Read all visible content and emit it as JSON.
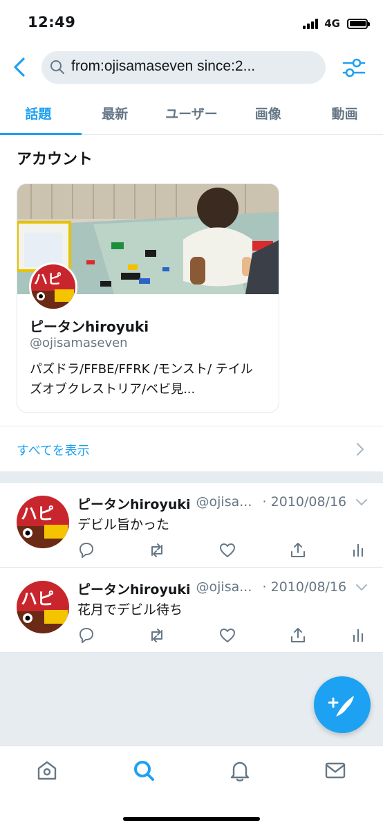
{
  "status_bar": {
    "time": "12:49",
    "network": "4G"
  },
  "search": {
    "query": "from:ojisamaseven since:2..."
  },
  "tabs": [
    {
      "label": "話題",
      "active": true
    },
    {
      "label": "最新",
      "active": false
    },
    {
      "label": "ユーザー",
      "active": false
    },
    {
      "label": "画像",
      "active": false
    },
    {
      "label": "動画",
      "active": false
    }
  ],
  "accounts_section": {
    "title": "アカウント",
    "card": {
      "name": "ピータンhiroyuki",
      "handle": "@ojisamaseven",
      "bio": "パズドラ/FFBE/FFRK /モンスト/ テイルズオブクレストリア/ベビ見..."
    },
    "show_all_label": "すべてを表示"
  },
  "tweets": [
    {
      "name": "ピータンhiroyuki",
      "handle": "@ojisa...",
      "date": "· 2010/08/16",
      "text": "デビル旨かった"
    },
    {
      "name": "ピータンhiroyuki",
      "handle": "@ojisa...",
      "date": "· 2010/08/16",
      "text": "花月でデビル待ち"
    }
  ],
  "icons": {
    "back": "chevron-left-icon",
    "search": "search-icon",
    "filter": "sliders-icon",
    "reply": "reply-icon",
    "retweet": "retweet-icon",
    "like": "heart-icon",
    "share": "share-icon",
    "analytics": "analytics-icon",
    "compose": "compose-tweet-icon",
    "nav": [
      "home-icon",
      "explore-icon",
      "notifications-icon",
      "messages-icon"
    ]
  },
  "colors": {
    "accent": "#1da1f2",
    "muted": "#657786",
    "band": "#e6ecf0",
    "text": "#14171a"
  }
}
